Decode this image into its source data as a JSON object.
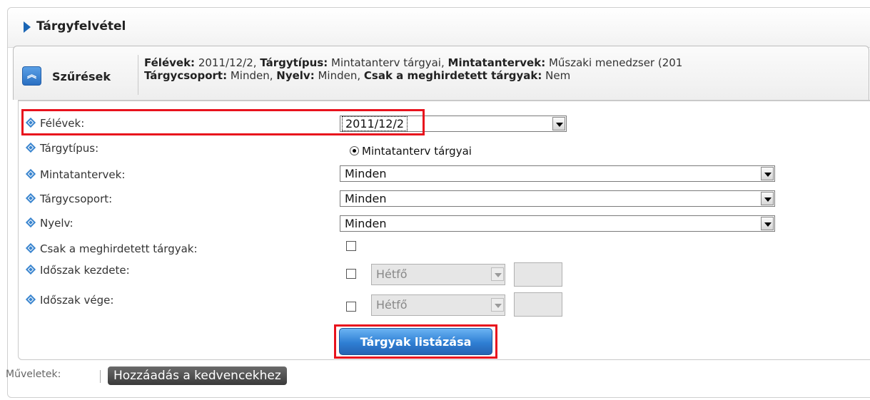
{
  "page": {
    "title": "Tárgyfelvétel"
  },
  "filter": {
    "toggle_label": "Szűrések",
    "summary": {
      "line1": [
        {
          "key": "Félévek:",
          "value": " 2011/12/2, "
        },
        {
          "key": "Tárgytípus:",
          "value": " Mintatanterv tárgyai, "
        },
        {
          "key": "Mintatantervek:",
          "value": " Műszaki menedzser (201"
        }
      ],
      "line2": [
        {
          "key": "Tárgycsoport:",
          "value": " Minden, "
        },
        {
          "key": "Nyelv:",
          "value": " Minden, "
        },
        {
          "key": "Csak a meghirdetett tárgyak:",
          "value": " Nem"
        }
      ]
    }
  },
  "form": {
    "felevek": {
      "label": "Félévek:",
      "value": "2011/12/2"
    },
    "targytipus": {
      "label": "Tárgytípus:",
      "option": "Mintatanterv tárgyai",
      "selected": true
    },
    "mintatantervek": {
      "label": "Mintatantervek:",
      "value": "Minden"
    },
    "targycsoport": {
      "label": "Tárgycsoport:",
      "value": "Minden"
    },
    "nyelv": {
      "label": "Nyelv:",
      "value": "Minden"
    },
    "csak_meghirdetett": {
      "label": "Csak a meghirdetett tárgyak:",
      "checked": false
    },
    "idoszak_kezdete": {
      "label": "Időszak kezdete:",
      "day": "Hétfő",
      "checked": false
    },
    "idoszak_vege": {
      "label": "Időszak vége:",
      "day": "Hétfő",
      "checked": false
    },
    "submit_label": "Tárgyak listázása"
  },
  "actions": {
    "label": "Műveletek:",
    "favorite_label": "Hozzáadás a kedvencekhez"
  },
  "colors": {
    "accent": "#2f7fd4",
    "highlight": "#e8121d"
  }
}
